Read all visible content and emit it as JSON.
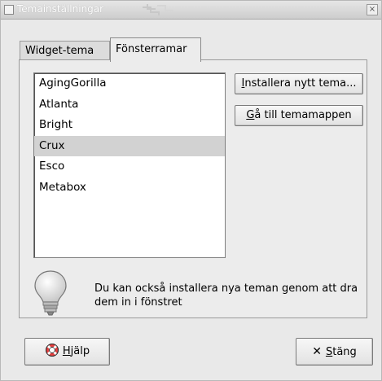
{
  "window": {
    "title": "Temainställningar"
  },
  "tabs": [
    {
      "label": "Widget-tema",
      "active": false
    },
    {
      "label": "Fönsterramar",
      "active": true
    }
  ],
  "theme_list": {
    "items": [
      "AgingGorilla",
      "Atlanta",
      "Bright",
      "Crux",
      "Esco",
      "Metabox"
    ],
    "selected": "Crux"
  },
  "buttons": {
    "install_prefix": "I",
    "install_rest": "nstallera nytt tema...",
    "folder_prefix": "G",
    "folder_rest": "å till temamappen",
    "help_prefix": "H",
    "help_rest": "jälp",
    "close_prefix": "S",
    "close_rest": "täng"
  },
  "hint": {
    "text": "Du kan också installera nya teman genom att dra dem in i fönstret"
  },
  "icons": {
    "help": "lifebuoy-icon",
    "close": "x-icon",
    "hint": "lightbulb-icon"
  }
}
